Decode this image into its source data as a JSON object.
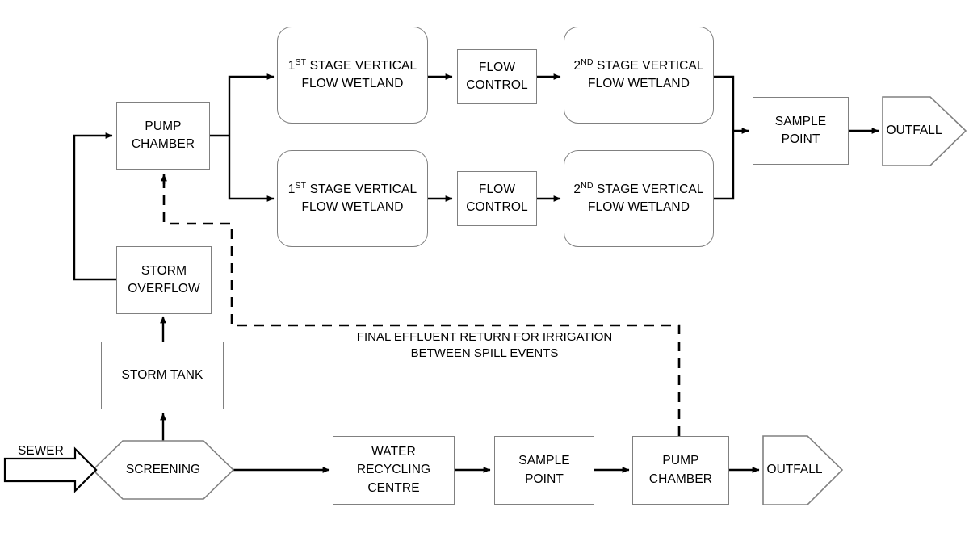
{
  "diagram": {
    "title": "Wastewater treatment wetland process flow diagram",
    "colors": {
      "shape_stroke": "#808080",
      "connector_stroke": "#000000",
      "text": "#000000",
      "background": "#ffffff"
    },
    "nodes": {
      "sewer_inlet": {
        "label": "SEWER",
        "shape": "block-arrow"
      },
      "screening": {
        "label": "SCREENING",
        "shape": "hexagon"
      },
      "storm_tank": {
        "label": "STORM TANK",
        "shape": "rectangle"
      },
      "storm_overflow": {
        "line1": "STORM",
        "line2": "OVERFLOW",
        "shape": "rectangle"
      },
      "pump_chamber_top": {
        "line1": "PUMP",
        "line2": "CHAMBER",
        "shape": "rectangle"
      },
      "wetland_1_stage1": {
        "line1_pre": "1",
        "line1_sup": "ST",
        "line1_post": " STAGE VERTICAL",
        "line2": "FLOW WETLAND",
        "shape": "rounded-rectangle"
      },
      "wetland_2_stage1": {
        "line1_pre": "1",
        "line1_sup": "ST",
        "line1_post": " STAGE VERTICAL",
        "line2": "FLOW WETLAND",
        "shape": "rounded-rectangle"
      },
      "flow_control_top": {
        "line1": "FLOW",
        "line2": "CONTROL",
        "shape": "rectangle"
      },
      "flow_control_bottom": {
        "line1": "FLOW",
        "line2": "CONTROL",
        "shape": "rectangle"
      },
      "wetland_1_stage2": {
        "line1_pre": "2",
        "line1_sup": "ND",
        "line1_post": " STAGE VERTICAL",
        "line2": "FLOW WETLAND",
        "shape": "rounded-rectangle"
      },
      "wetland_2_stage2": {
        "line1_pre": "2",
        "line1_sup": "ND",
        "line1_post": " STAGE VERTICAL",
        "line2": "FLOW WETLAND",
        "shape": "rounded-rectangle"
      },
      "sample_point_top": {
        "line1": "SAMPLE",
        "line2": "POINT",
        "shape": "rectangle"
      },
      "outfall_top": {
        "label": "OUTFALL",
        "shape": "pentagon-arrow"
      },
      "water_recycling_centre": {
        "line1": "WATER",
        "line2": "RECYCLING",
        "line3": "CENTRE",
        "shape": "rectangle"
      },
      "sample_point_bottom": {
        "line1": "SAMPLE",
        "line2": "POINT",
        "shape": "rectangle"
      },
      "pump_chamber_bottom": {
        "line1": "PUMP",
        "line2": "CHAMBER",
        "shape": "rectangle"
      },
      "outfall_bottom": {
        "label": "OUTFALL",
        "shape": "pentagon-arrow"
      }
    },
    "edge_labels": {
      "effluent_return": {
        "line1": "FINAL EFFLUENT RETURN FOR IRRIGATION",
        "line2": "BETWEEN SPILL EVENTS"
      }
    }
  }
}
